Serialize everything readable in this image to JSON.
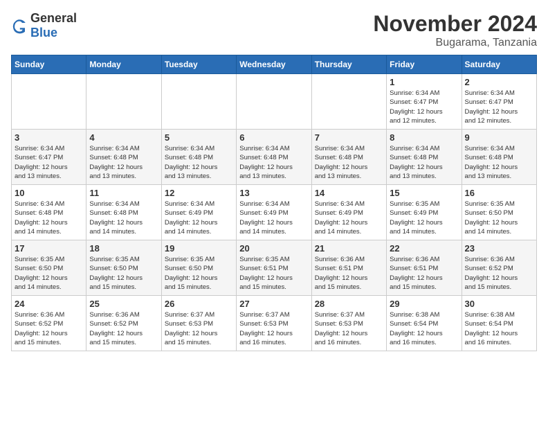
{
  "logo": {
    "general": "General",
    "blue": "Blue"
  },
  "header": {
    "month": "November 2024",
    "location": "Bugarama, Tanzania"
  },
  "weekdays": [
    "Sunday",
    "Monday",
    "Tuesday",
    "Wednesday",
    "Thursday",
    "Friday",
    "Saturday"
  ],
  "weeks": [
    [
      {
        "day": "",
        "info": ""
      },
      {
        "day": "",
        "info": ""
      },
      {
        "day": "",
        "info": ""
      },
      {
        "day": "",
        "info": ""
      },
      {
        "day": "",
        "info": ""
      },
      {
        "day": "1",
        "info": "Sunrise: 6:34 AM\nSunset: 6:47 PM\nDaylight: 12 hours\nand 12 minutes."
      },
      {
        "day": "2",
        "info": "Sunrise: 6:34 AM\nSunset: 6:47 PM\nDaylight: 12 hours\nand 12 minutes."
      }
    ],
    [
      {
        "day": "3",
        "info": "Sunrise: 6:34 AM\nSunset: 6:47 PM\nDaylight: 12 hours\nand 13 minutes."
      },
      {
        "day": "4",
        "info": "Sunrise: 6:34 AM\nSunset: 6:48 PM\nDaylight: 12 hours\nand 13 minutes."
      },
      {
        "day": "5",
        "info": "Sunrise: 6:34 AM\nSunset: 6:48 PM\nDaylight: 12 hours\nand 13 minutes."
      },
      {
        "day": "6",
        "info": "Sunrise: 6:34 AM\nSunset: 6:48 PM\nDaylight: 12 hours\nand 13 minutes."
      },
      {
        "day": "7",
        "info": "Sunrise: 6:34 AM\nSunset: 6:48 PM\nDaylight: 12 hours\nand 13 minutes."
      },
      {
        "day": "8",
        "info": "Sunrise: 6:34 AM\nSunset: 6:48 PM\nDaylight: 12 hours\nand 13 minutes."
      },
      {
        "day": "9",
        "info": "Sunrise: 6:34 AM\nSunset: 6:48 PM\nDaylight: 12 hours\nand 13 minutes."
      }
    ],
    [
      {
        "day": "10",
        "info": "Sunrise: 6:34 AM\nSunset: 6:48 PM\nDaylight: 12 hours\nand 14 minutes."
      },
      {
        "day": "11",
        "info": "Sunrise: 6:34 AM\nSunset: 6:48 PM\nDaylight: 12 hours\nand 14 minutes."
      },
      {
        "day": "12",
        "info": "Sunrise: 6:34 AM\nSunset: 6:49 PM\nDaylight: 12 hours\nand 14 minutes."
      },
      {
        "day": "13",
        "info": "Sunrise: 6:34 AM\nSunset: 6:49 PM\nDaylight: 12 hours\nand 14 minutes."
      },
      {
        "day": "14",
        "info": "Sunrise: 6:34 AM\nSunset: 6:49 PM\nDaylight: 12 hours\nand 14 minutes."
      },
      {
        "day": "15",
        "info": "Sunrise: 6:35 AM\nSunset: 6:49 PM\nDaylight: 12 hours\nand 14 minutes."
      },
      {
        "day": "16",
        "info": "Sunrise: 6:35 AM\nSunset: 6:50 PM\nDaylight: 12 hours\nand 14 minutes."
      }
    ],
    [
      {
        "day": "17",
        "info": "Sunrise: 6:35 AM\nSunset: 6:50 PM\nDaylight: 12 hours\nand 14 minutes."
      },
      {
        "day": "18",
        "info": "Sunrise: 6:35 AM\nSunset: 6:50 PM\nDaylight: 12 hours\nand 15 minutes."
      },
      {
        "day": "19",
        "info": "Sunrise: 6:35 AM\nSunset: 6:50 PM\nDaylight: 12 hours\nand 15 minutes."
      },
      {
        "day": "20",
        "info": "Sunrise: 6:35 AM\nSunset: 6:51 PM\nDaylight: 12 hours\nand 15 minutes."
      },
      {
        "day": "21",
        "info": "Sunrise: 6:36 AM\nSunset: 6:51 PM\nDaylight: 12 hours\nand 15 minutes."
      },
      {
        "day": "22",
        "info": "Sunrise: 6:36 AM\nSunset: 6:51 PM\nDaylight: 12 hours\nand 15 minutes."
      },
      {
        "day": "23",
        "info": "Sunrise: 6:36 AM\nSunset: 6:52 PM\nDaylight: 12 hours\nand 15 minutes."
      }
    ],
    [
      {
        "day": "24",
        "info": "Sunrise: 6:36 AM\nSunset: 6:52 PM\nDaylight: 12 hours\nand 15 minutes."
      },
      {
        "day": "25",
        "info": "Sunrise: 6:36 AM\nSunset: 6:52 PM\nDaylight: 12 hours\nand 15 minutes."
      },
      {
        "day": "26",
        "info": "Sunrise: 6:37 AM\nSunset: 6:53 PM\nDaylight: 12 hours\nand 15 minutes."
      },
      {
        "day": "27",
        "info": "Sunrise: 6:37 AM\nSunset: 6:53 PM\nDaylight: 12 hours\nand 16 minutes."
      },
      {
        "day": "28",
        "info": "Sunrise: 6:37 AM\nSunset: 6:53 PM\nDaylight: 12 hours\nand 16 minutes."
      },
      {
        "day": "29",
        "info": "Sunrise: 6:38 AM\nSunset: 6:54 PM\nDaylight: 12 hours\nand 16 minutes."
      },
      {
        "day": "30",
        "info": "Sunrise: 6:38 AM\nSunset: 6:54 PM\nDaylight: 12 hours\nand 16 minutes."
      }
    ]
  ]
}
